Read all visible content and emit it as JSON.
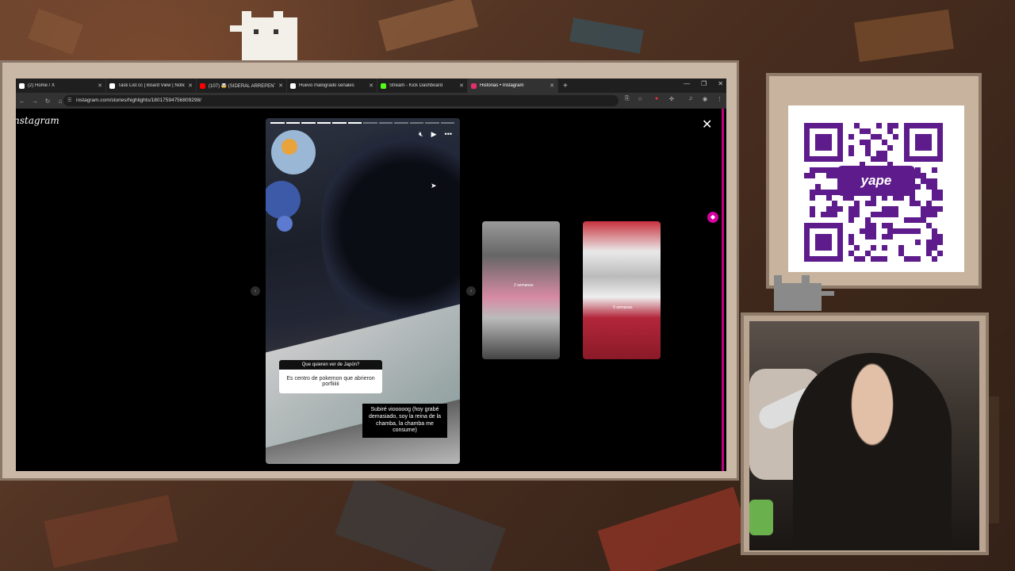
{
  "browser": {
    "tabs": [
      {
        "title": "(2) Home / X",
        "favicon_color": "#ffffff",
        "active": false
      },
      {
        "title": "Task List cc | Board View | Notion",
        "favicon_color": "#ffffff",
        "active": false
      },
      {
        "title": "(107) 🤯 (SIDERAL ARREPENTI",
        "favicon_color": "#ff0000",
        "active": false
      },
      {
        "title": "Huevo malogrado señales",
        "favicon_color": "#ffffff",
        "active": false
      },
      {
        "title": "Stream - Kick Dashboard",
        "favicon_color": "#53fc18",
        "active": false
      },
      {
        "title": "Historias • Instagram",
        "favicon_color": "#e1306c",
        "active": true
      }
    ],
    "new_tab_label": "+",
    "url": "instagram.com/stories/highlights/18017594756809298/"
  },
  "instagram": {
    "logo_text": "nstagram",
    "story": {
      "progress_segments": 12,
      "progress_done": 6,
      "question_header": "Que quieren ver de Japón?",
      "question_answer": "Es centro de pokemon que abrieron porfiiiiii",
      "reply_text": "Subiré viooooog (hoy grabé demasiado, soy la reina de la chamba, la chamba me consume)"
    },
    "thumbnails": [
      {
        "label": "2 semanas"
      },
      {
        "label": "9 semanas"
      }
    ],
    "accent_color": "#c0037e"
  },
  "overlay": {
    "qr_brand": "yape",
    "qr_brand_color": "#5d1b8c"
  }
}
